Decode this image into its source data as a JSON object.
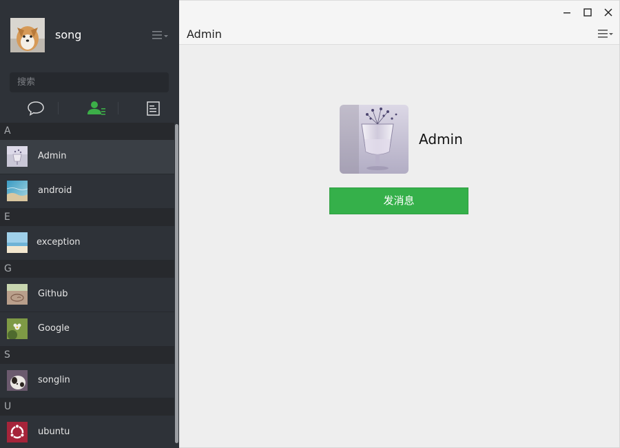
{
  "user": {
    "name": "song"
  },
  "search": {
    "placeholder": "搜索"
  },
  "nav_tabs": [
    {
      "name": "chats",
      "icon": "chat-bubble-icon",
      "active": false
    },
    {
      "name": "contacts",
      "icon": "contacts-icon",
      "active": true
    },
    {
      "name": "favorites",
      "icon": "document-icon",
      "active": false
    }
  ],
  "contact_groups": [
    {
      "letter": "A",
      "contacts": [
        {
          "name": "Admin",
          "selected": true
        },
        {
          "name": "android",
          "selected": false
        }
      ]
    },
    {
      "letter": "E",
      "contacts": [
        {
          "name": "exception",
          "selected": false
        }
      ]
    },
    {
      "letter": "G",
      "contacts": [
        {
          "name": "Github",
          "selected": false
        },
        {
          "name": "Google",
          "selected": false
        }
      ]
    },
    {
      "letter": "S",
      "contacts": [
        {
          "name": "songlin",
          "selected": false
        }
      ]
    },
    {
      "letter": "U",
      "contacts": [
        {
          "name": "ubuntu",
          "selected": false
        }
      ]
    }
  ],
  "main": {
    "title": "Admin",
    "profile_name": "Admin",
    "send_button_label": "发消息"
  },
  "colors": {
    "sidebar_bg": "#2e3238",
    "active_icon": "#3caf48",
    "send_button": "#35b04a",
    "main_bg": "#eeeeee"
  }
}
